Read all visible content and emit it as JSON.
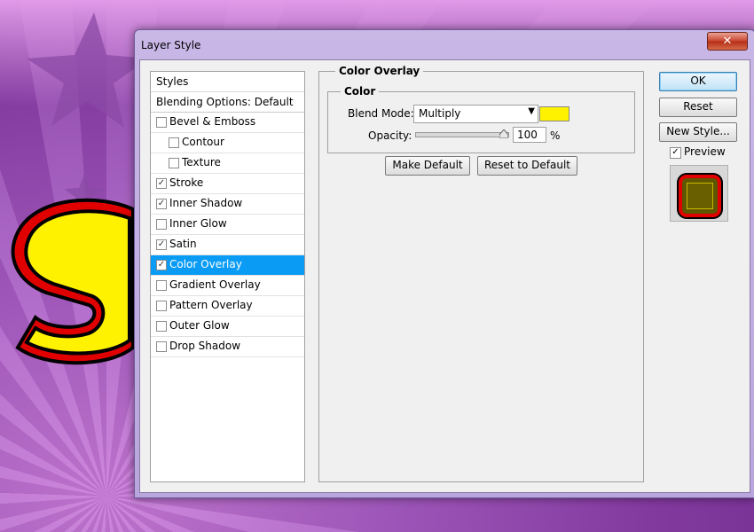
{
  "dialog": {
    "title": "Layer Style",
    "close_glyph": "✕"
  },
  "styles_panel": {
    "header": "Styles",
    "blending_options": "Blending Options: Default",
    "items": [
      {
        "label": "Bevel & Emboss",
        "checked": false,
        "indent": false,
        "selected": false
      },
      {
        "label": "Contour",
        "checked": false,
        "indent": true,
        "selected": false
      },
      {
        "label": "Texture",
        "checked": false,
        "indent": true,
        "selected": false
      },
      {
        "label": "Stroke",
        "checked": true,
        "indent": false,
        "selected": false
      },
      {
        "label": "Inner Shadow",
        "checked": true,
        "indent": false,
        "selected": false
      },
      {
        "label": "Inner Glow",
        "checked": false,
        "indent": false,
        "selected": false
      },
      {
        "label": "Satin",
        "checked": true,
        "indent": false,
        "selected": false
      },
      {
        "label": "Color Overlay",
        "checked": true,
        "indent": false,
        "selected": true
      },
      {
        "label": "Gradient Overlay",
        "checked": false,
        "indent": false,
        "selected": false
      },
      {
        "label": "Pattern Overlay",
        "checked": false,
        "indent": false,
        "selected": false
      },
      {
        "label": "Outer Glow",
        "checked": false,
        "indent": false,
        "selected": false
      },
      {
        "label": "Drop Shadow",
        "checked": false,
        "indent": false,
        "selected": false
      }
    ]
  },
  "color_overlay": {
    "section_title": "Color Overlay",
    "group_title": "Color",
    "blend_mode_label": "Blend Mode:",
    "blend_mode_value": "Multiply",
    "overlay_color": "#fff200",
    "opacity_label": "Opacity:",
    "opacity_value": "100",
    "opacity_fraction": 1.0,
    "percent_sign": "%",
    "make_default": "Make Default",
    "reset_to_default": "Reset to Default"
  },
  "actions": {
    "ok": "OK",
    "reset": "Reset",
    "new_style": "New Style...",
    "preview_label": "Preview",
    "preview_checked": true
  },
  "colors": {
    "selection": "#0a9cf5",
    "preview_stroke": "#e00000",
    "preview_fill": "#5e5600"
  }
}
